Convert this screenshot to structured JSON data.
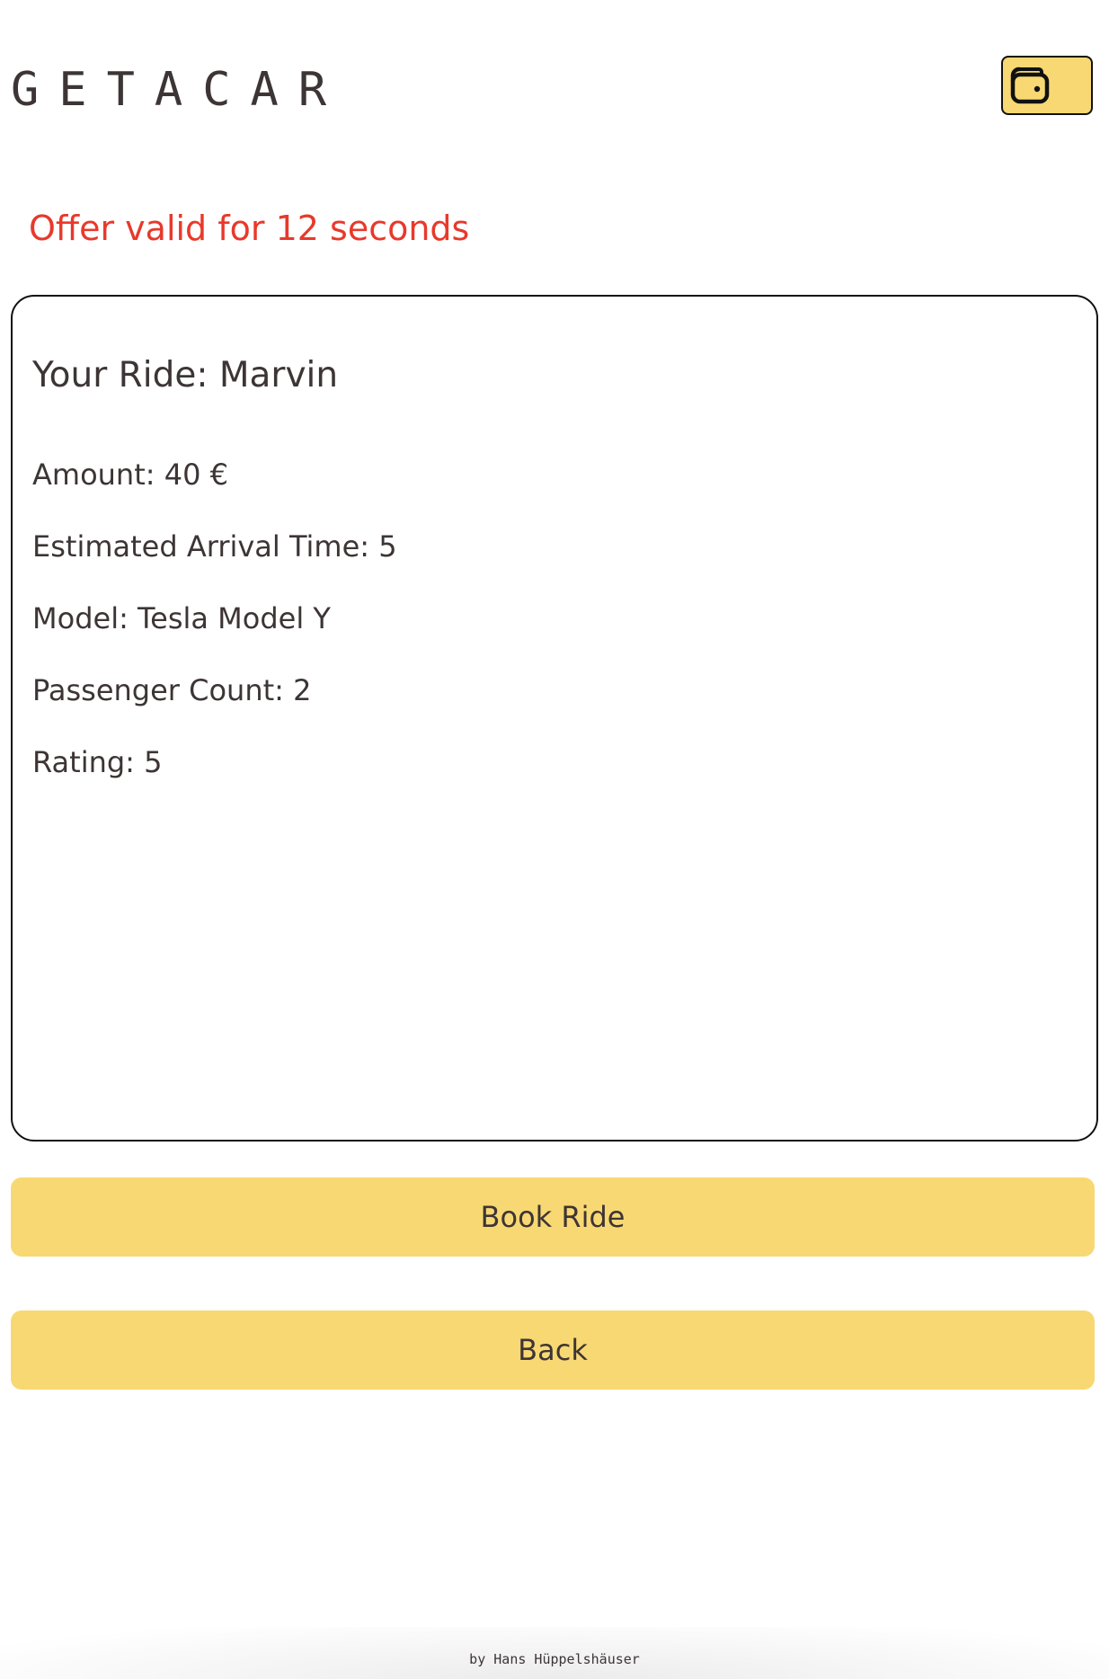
{
  "header": {
    "logo": "GETACAR",
    "wallet_icon": "wallet-icon"
  },
  "offer": {
    "timer_text": "Offer valid for 12 seconds"
  },
  "ride": {
    "title": "Your Ride: Marvin",
    "amount": "Amount: 40 €",
    "eta": "Estimated Arrival Time: 5",
    "model": "Model: Tesla Model Y",
    "passengers": "Passenger Count: 2",
    "rating": "Rating: 5"
  },
  "actions": {
    "book_label": "Book Ride",
    "back_label": "Back"
  },
  "footer": {
    "credit": "by Hans Hüppelshäuser"
  },
  "colors": {
    "accent": "#f8d873",
    "timer": "#e8392b",
    "text": "#3d3535"
  }
}
